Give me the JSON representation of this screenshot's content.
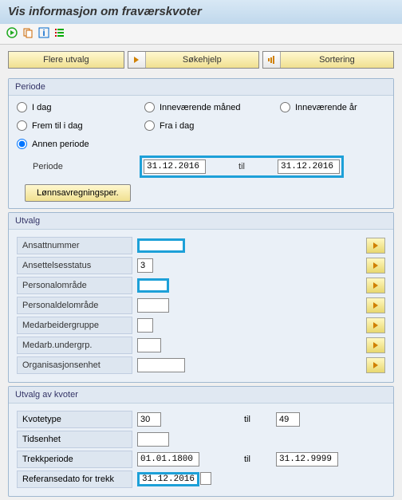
{
  "title": "Vis informasjon om fraværskvoter",
  "buttons": {
    "flere": "Flere utvalg",
    "soke": "Søkehjelp",
    "sort": "Sortering"
  },
  "periode": {
    "title": "Periode",
    "idag": "I dag",
    "inn_maned": "Inneværende måned",
    "inn_ar": "Inneværende år",
    "frem": "Frem til i dag",
    "fra": "Fra i dag",
    "annen": "Annen periode",
    "periode_lbl": "Periode",
    "from": "31.12.2016",
    "til_lbl": "til",
    "to": "31.12.2016",
    "lonns": "Lønnsavregningsper."
  },
  "utvalg": {
    "title": "Utvalg",
    "rows": [
      {
        "label": "Ansattnummer",
        "val": "",
        "hl": true
      },
      {
        "label": "Ansettelsesstatus",
        "val": "3"
      },
      {
        "label": "Personalområde",
        "val": "",
        "hl": true
      },
      {
        "label": "Personaldelområde",
        "val": ""
      },
      {
        "label": "Medarbeidergruppe",
        "val": ""
      },
      {
        "label": "Medarb.undergrp.",
        "val": ""
      },
      {
        "label": "Organisasjonsenhet",
        "val": ""
      }
    ]
  },
  "kvoter": {
    "title": "Utvalg av kvoter",
    "kvotetype": "Kvotetype",
    "kvotetype_from": "30",
    "kvotetype_to": "49",
    "tidsenhet": "Tidsenhet",
    "tidsenhet_val": "",
    "trekk": "Trekkperiode",
    "trekk_from": "01.01.1800",
    "trekk_to": "31.12.9999",
    "ref": "Referansedato for trekk",
    "ref_val": "31.12.2016",
    "til_lbl": "til"
  }
}
